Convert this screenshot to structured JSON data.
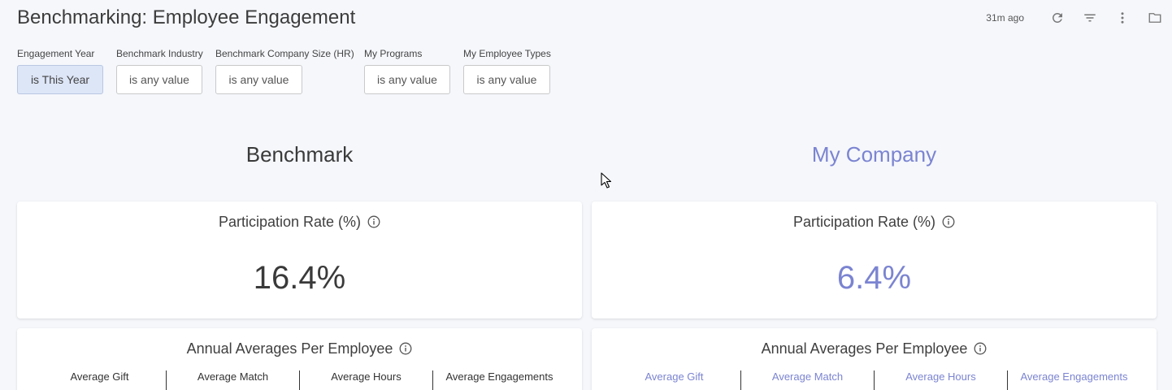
{
  "header": {
    "title": "Benchmarking: Employee Engagement",
    "updated": "31m ago",
    "icons": [
      "refresh-icon",
      "filter-icon",
      "more-vert-icon",
      "folder-icon"
    ]
  },
  "filters": [
    {
      "label": "Engagement Year",
      "value": "is This Year",
      "active": true
    },
    {
      "label": "Benchmark Industry",
      "value": "is any value",
      "active": false
    },
    {
      "label": "Benchmark Company Size (HR)",
      "value": "is any value",
      "active": false
    },
    {
      "label": "My Programs",
      "value": "is any value",
      "active": false
    },
    {
      "label": "My Employee Types",
      "value": "is any value",
      "active": false
    }
  ],
  "benchmark": {
    "heading": "Benchmark",
    "participation": {
      "title": "Participation Rate (%)",
      "value": "16.4%"
    },
    "averages": {
      "title": "Annual Averages Per Employee",
      "columns": [
        "Average Gift",
        "Average Match",
        "Average Hours",
        "Average Engagements"
      ]
    }
  },
  "my_company": {
    "heading": "My Company",
    "participation": {
      "title": "Participation Rate (%)",
      "value": "6.4%"
    },
    "averages": {
      "title": "Annual Averages Per Employee",
      "columns": [
        "Average Gift",
        "Average Match",
        "Average Hours",
        "Average Engagements"
      ]
    }
  },
  "colors": {
    "accent": "#7b84d1",
    "active_filter_bg": "#dde6f7",
    "page_bg": "#f5f7fb"
  }
}
